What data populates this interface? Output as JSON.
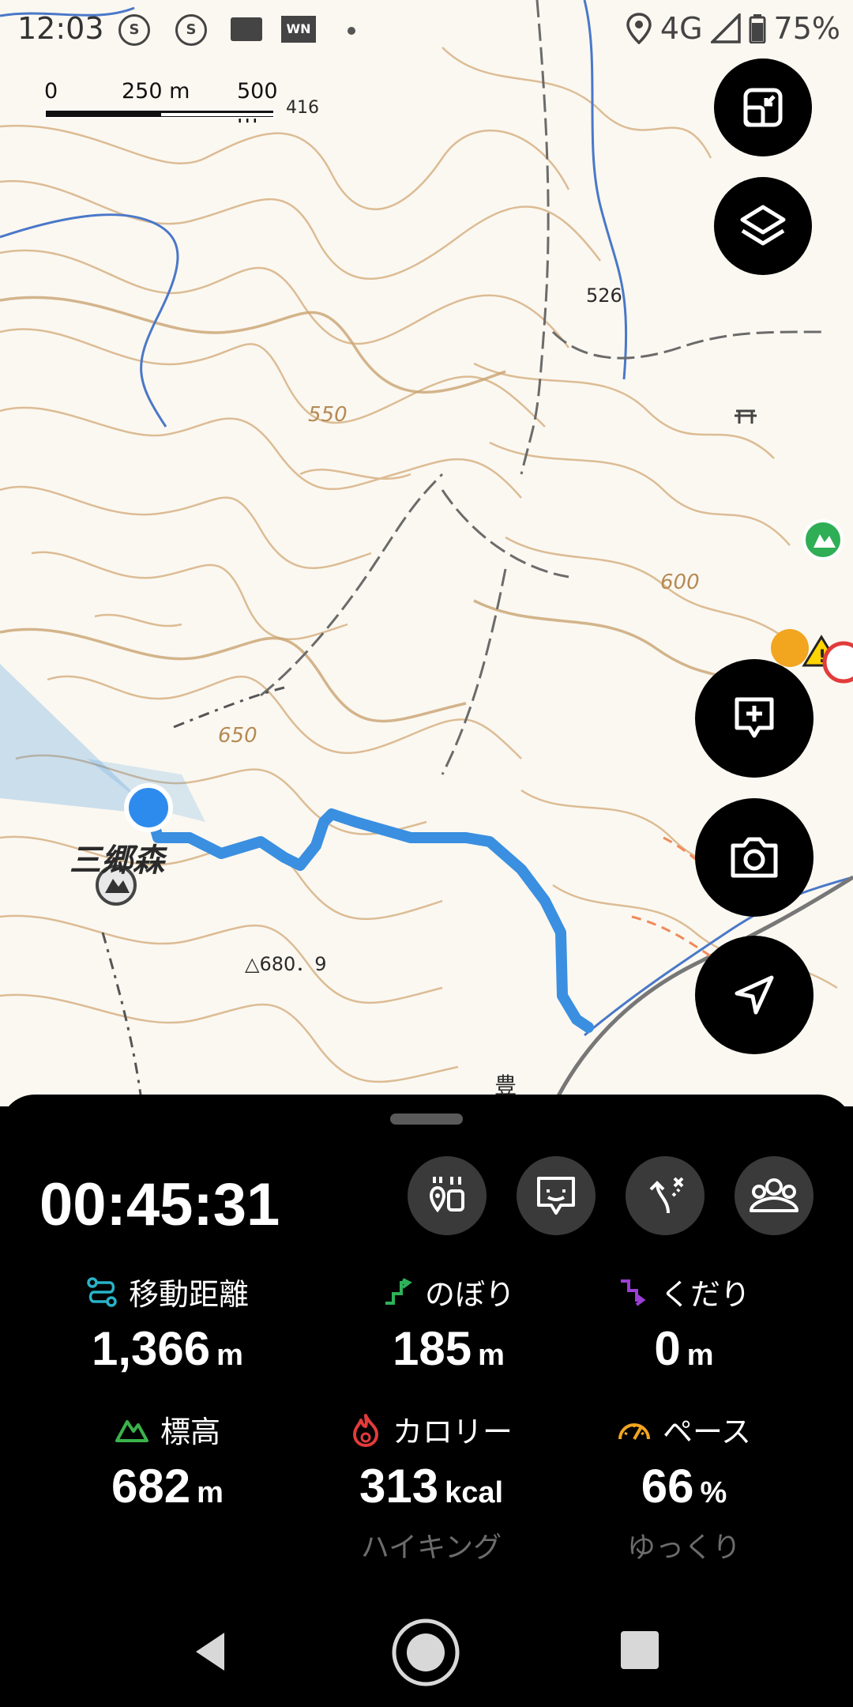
{
  "status_bar": {
    "time": "12:03",
    "notif_icons": [
      "sim-icon",
      "sim-icon",
      "mail-icon",
      "wn-icon"
    ],
    "network": "4G",
    "battery": "75%"
  },
  "map": {
    "scale": {
      "labels": [
        "0",
        "250 m",
        "500 m"
      ]
    },
    "contour_labels": [
      "550",
      "600",
      "650",
      "526",
      "416"
    ],
    "peak_label": "三郷森",
    "elevation_point": "△680．9",
    "place_label": "豊"
  },
  "map_buttons": [
    {
      "name": "fullscreen-toggle-button",
      "icon": "exit-fullscreen-icon"
    },
    {
      "name": "map-layers-button",
      "icon": "layers-icon"
    },
    {
      "name": "add-memo-button",
      "icon": "add-comment-icon"
    },
    {
      "name": "camera-button",
      "icon": "camera-icon"
    },
    {
      "name": "current-location-button",
      "icon": "navigation-arrow-icon"
    }
  ],
  "sheet": {
    "elapsed_time": "00:45:31",
    "tools": [
      "trail-info-icon",
      "check-in-icon",
      "route-icon",
      "group-icon"
    ],
    "stats": [
      {
        "label": "移動距離",
        "value": "1,366",
        "unit": "m",
        "icon": "distance-icon",
        "color": "#27b3c8"
      },
      {
        "label": "のぼり",
        "value": "185",
        "unit": "m",
        "icon": "ascent-icon",
        "color": "#2fb15a"
      },
      {
        "label": "くだり",
        "value": "0",
        "unit": "m",
        "icon": "descent-icon",
        "color": "#9b3fd6"
      },
      {
        "label": "標高",
        "value": "682",
        "unit": "m",
        "icon": "mountain-icon",
        "color": "#3bb24c"
      },
      {
        "label": "カロリー",
        "value": "313",
        "unit": "kcal",
        "icon": "fire-icon",
        "color": "#e23b3b",
        "sub": "ハイキング"
      },
      {
        "label": "ペース",
        "value": "66",
        "unit": "%",
        "icon": "speedometer-icon",
        "color": "#f2a51f",
        "sub": "ゆっくり"
      }
    ]
  },
  "colors": {
    "track": "#3a8fe0",
    "location_dot": "#2e8bee",
    "contour": "#d8b48a",
    "river": "#4a78c9"
  },
  "nav": [
    "back-icon",
    "home-icon",
    "recents-icon"
  ]
}
